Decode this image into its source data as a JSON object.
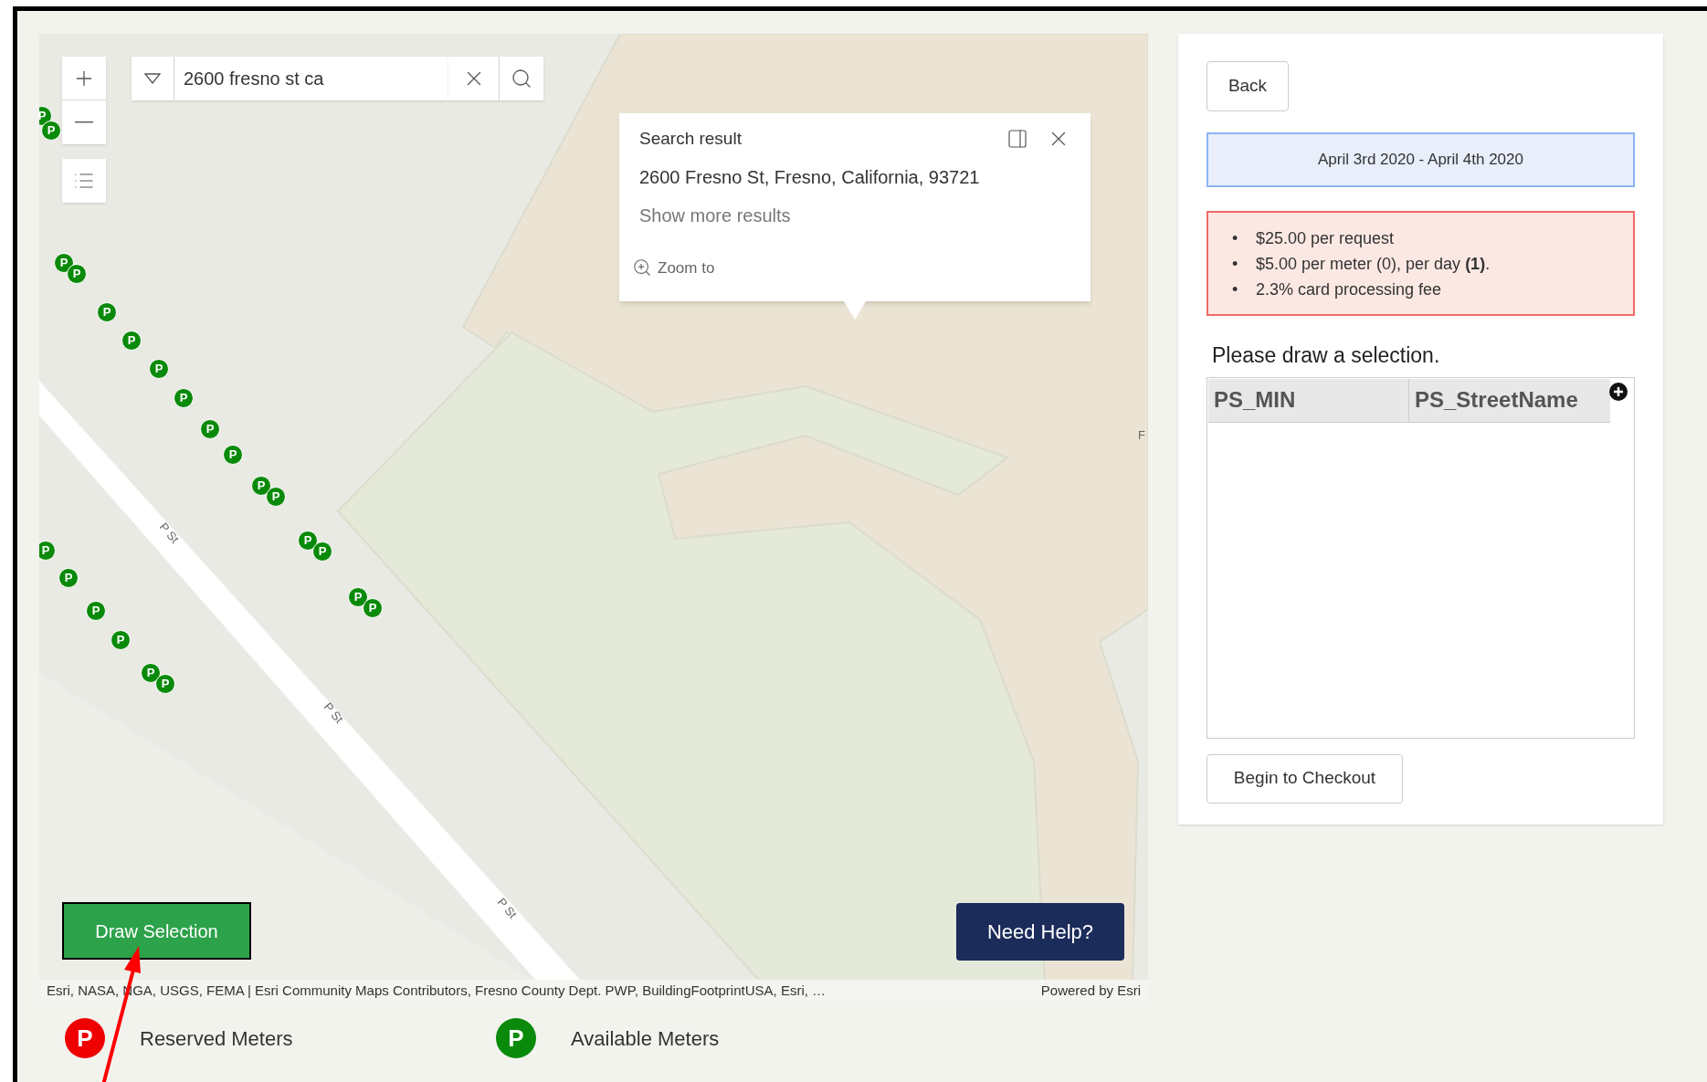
{
  "search": {
    "value": "2600 fresno st ca"
  },
  "map": {
    "street_labels": [
      "P St",
      "P St",
      "P St",
      "F"
    ],
    "markers": [
      {
        "symbol": "P"
      },
      {
        "symbol": "P"
      },
      {
        "symbol": "P"
      },
      {
        "symbol": "P"
      },
      {
        "symbol": "P"
      },
      {
        "symbol": "P"
      },
      {
        "symbol": "P"
      },
      {
        "symbol": "P"
      },
      {
        "symbol": "P"
      },
      {
        "symbol": "P"
      },
      {
        "symbol": "P"
      },
      {
        "symbol": "P"
      },
      {
        "symbol": "P"
      },
      {
        "symbol": "P"
      },
      {
        "symbol": "P"
      },
      {
        "symbol": "P"
      },
      {
        "symbol": "P"
      },
      {
        "symbol": "P"
      },
      {
        "symbol": "P"
      },
      {
        "symbol": "P"
      },
      {
        "symbol": "P"
      },
      {
        "symbol": "P"
      }
    ]
  },
  "popup": {
    "title": "Search result",
    "address": "2600 Fresno St, Fresno, California, 93721",
    "more_link": "Show more results",
    "zoom_link": "Zoom to"
  },
  "draw_button": "Draw Selection",
  "help_button": "Need Help?",
  "attribution": {
    "sources": "Esri, NASA, NGA, USGS, FEMA | Esri Community Maps Contributors, Fresno County Dept. PWP, BuildingFootprintUSA, Esri, …",
    "powered_by": "Powered by Esri"
  },
  "legend": [
    {
      "symbol": "P",
      "label": "Reserved Meters",
      "color": "#ee0000"
    },
    {
      "symbol": "P",
      "label": "Available Meters",
      "color": "#0a8a0a"
    }
  ],
  "panel": {
    "back": "Back",
    "date_range": "April 3rd 2020 - April 4th 2020",
    "fees": [
      {
        "bullet": "•",
        "text": "$25.00 per request"
      },
      {
        "bullet": "•",
        "text": "$5.00 per meter (0), per day **(1)**."
      },
      {
        "bullet": "•",
        "text": "2.3% card processing fee"
      }
    ],
    "prompt": "Please draw a selection.",
    "table": {
      "columns": [
        "PS_MIN",
        "PS_StreetName"
      ]
    },
    "checkout": "Begin to Checkout"
  }
}
